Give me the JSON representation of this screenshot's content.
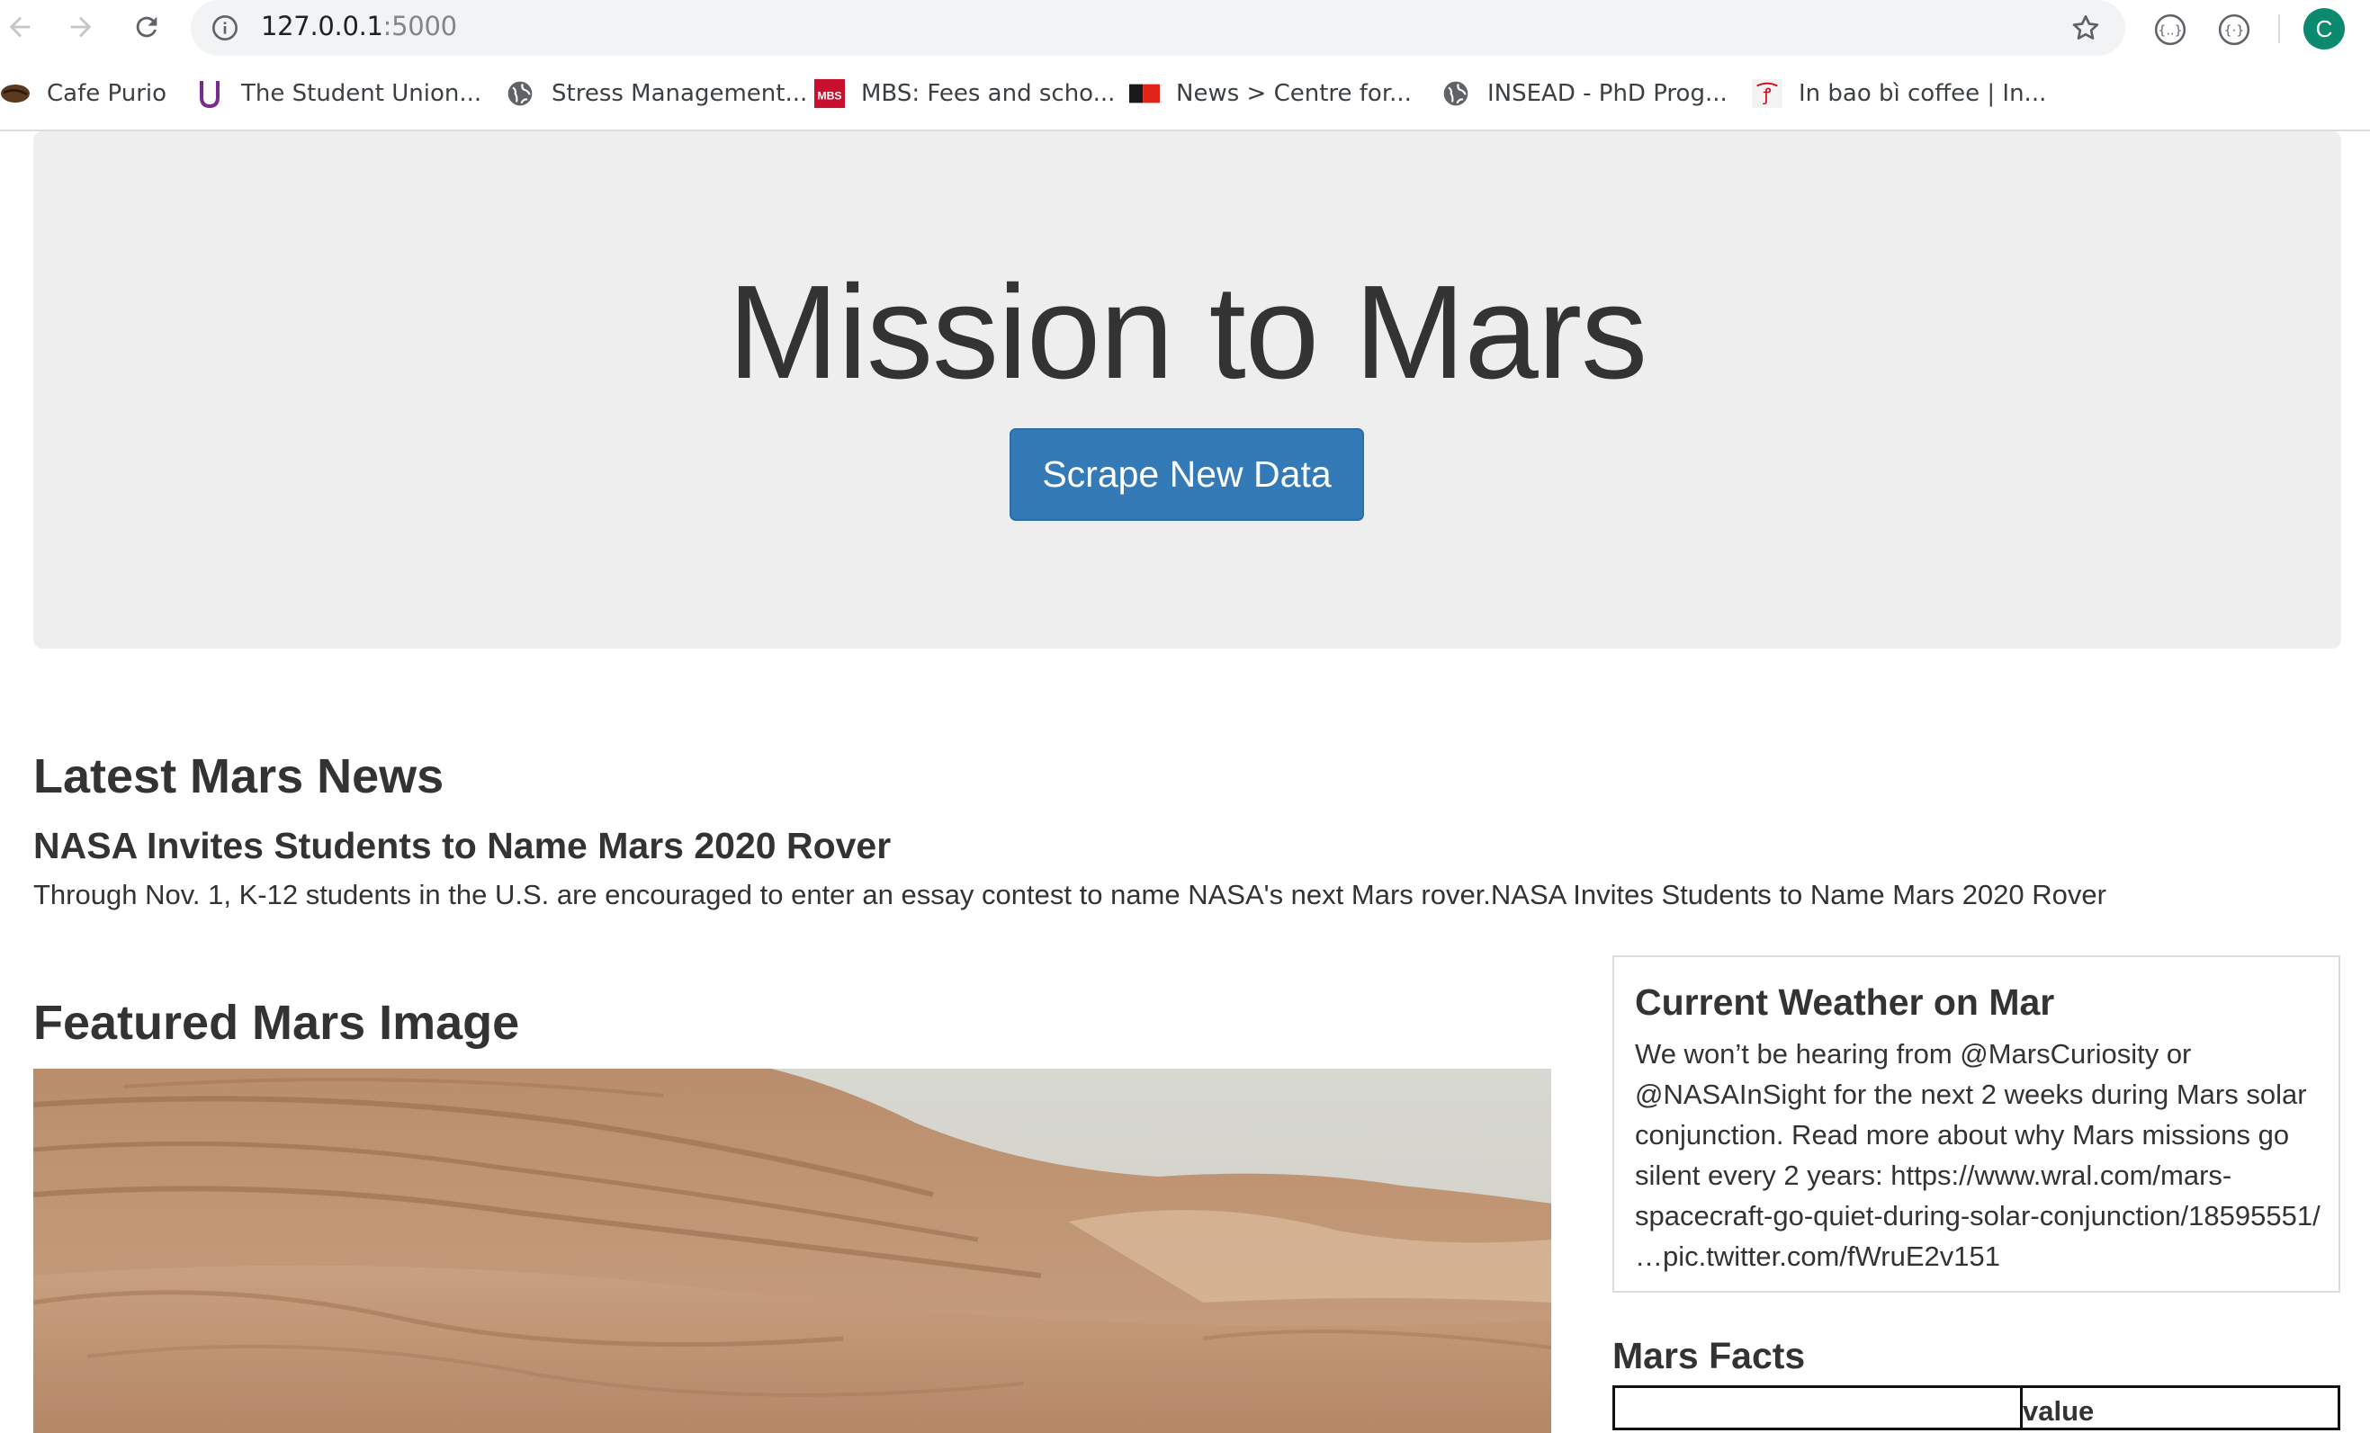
{
  "browser": {
    "url_host": "127.0.0.1",
    "url_port": ":5000",
    "profile_initial": "C",
    "bookmarks": [
      {
        "label": "Cafe Purio",
        "icon": "coffee-bean-icon"
      },
      {
        "label": "The Student Union...",
        "icon": "u-logo-icon"
      },
      {
        "label": "Stress Management...",
        "icon": "globe-icon"
      },
      {
        "label": "MBS: Fees and scho...",
        "icon": "mbs-logo-icon"
      },
      {
        "label": "News > Centre for...",
        "icon": "flag-icon"
      },
      {
        "label": "INSEAD - PhD Prog...",
        "icon": "globe-icon"
      },
      {
        "label": "In bao bì coffee | In...",
        "icon": "cup-logo-icon"
      }
    ]
  },
  "jumbotron": {
    "title": "Mission to Mars",
    "button_label": "Scrape New Data"
  },
  "news": {
    "heading": "Latest Mars News",
    "title": "NASA Invites Students to Name Mars 2020 Rover",
    "paragraph": "Through Nov. 1, K-12 students in the U.S. are encouraged to enter an essay contest to name NASA's next Mars rover.NASA Invites Students to Name Mars 2020 Rover"
  },
  "featured": {
    "heading": "Featured Mars Image"
  },
  "weather": {
    "heading": "Current Weather on Mar",
    "text": "We won’t be hearing from @MarsCuriosity or @NASAInSight for the next 2 weeks during Mars solar conjunction. Read more about why Mars missions go silent every 2 years: https://www.wral.com/mars-spacecraft-go-quiet-during-solar-conjunction/18595551/ …pic.twitter.com/fWruE2v151"
  },
  "facts": {
    "heading": "Mars Facts",
    "columns": [
      "",
      "value"
    ]
  },
  "colors": {
    "primary_button": "#337ab7",
    "jumbotron_bg": "#eeeeee",
    "profile_avatar": "#0b8a6f"
  }
}
